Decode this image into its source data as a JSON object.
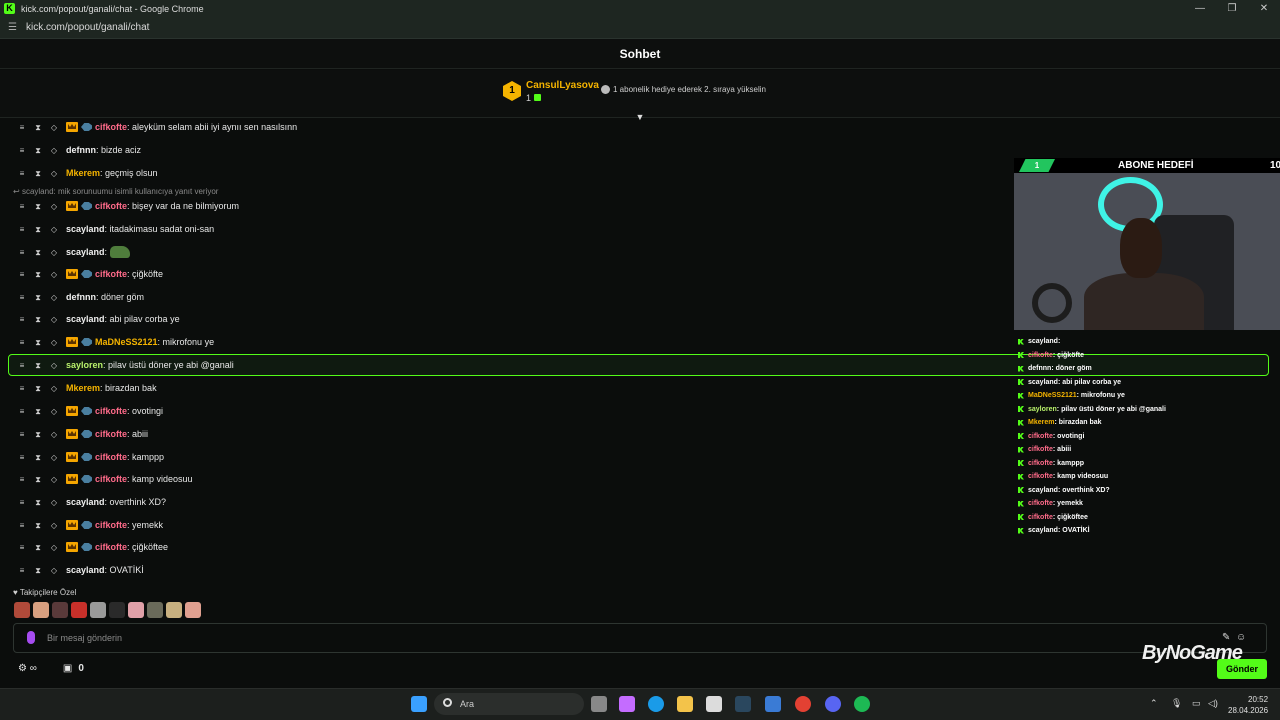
{
  "window": {
    "title": "kick.com/popout/ganali/chat - Google Chrome",
    "url": "kick.com/popout/ganali/chat"
  },
  "chat": {
    "header_title": "Sohbet",
    "pinned": {
      "rank": "1",
      "username": "CansulLyasova",
      "count": "1",
      "hint": "1 abonelik hediye ederek 2. sıraya yükselin"
    },
    "reply_hint": "scayland: mik sorunuumu isimli kullanıcıya yanıt veriyor",
    "messages": [
      {
        "user": "cifkofte",
        "text": ": aleyküm selam abii iyi aynıı sen nasılsınn",
        "color": "#ff6b8a",
        "badges": true
      },
      {
        "user": "defnnn",
        "text": ": bizde aciz",
        "color": "#f0f0f0",
        "badges": false
      },
      {
        "user": "Mkerem",
        "text": ": geçmiş olsun",
        "color": "#f5b400",
        "badges": false
      },
      {
        "user": "cifkofte",
        "text": ": bişey var da ne bilmiyorum",
        "color": "#ff6b8a",
        "badges": true
      },
      {
        "user": "scayland",
        "text": ": itadakimasu sadat oni-san",
        "color": "#f0f0f0",
        "badges": false
      },
      {
        "user": "scayland",
        "text": ":",
        "color": "#f0f0f0",
        "badges": false,
        "emote": true
      },
      {
        "user": "cifkofte",
        "text": ": çiğköfte",
        "color": "#ff6b8a",
        "badges": true
      },
      {
        "user": "defnnn",
        "text": ": döner göm",
        "color": "#f0f0f0",
        "badges": false
      },
      {
        "user": "scayland",
        "text": ": abi pilav corba ye",
        "color": "#f0f0f0",
        "badges": false
      },
      {
        "user": "MaDNeSS2121",
        "text": ": mikrofonu ye",
        "color": "#f5b400",
        "badges": true
      },
      {
        "user": "sayloren",
        "text": ": pilav üstü döner ye abi @ganali",
        "color": "#b9f26b",
        "badges": false
      },
      {
        "user": "Mkerem",
        "text": ": birazdan bak",
        "color": "#f5b400",
        "badges": false
      },
      {
        "user": "cifkofte",
        "text": ": ovotingi",
        "color": "#ff6b8a",
        "badges": true
      },
      {
        "user": "cifkofte",
        "text": ": abiii",
        "color": "#ff6b8a",
        "badges": true
      },
      {
        "user": "cifkofte",
        "text": ": kamppp",
        "color": "#ff6b8a",
        "badges": true
      },
      {
        "user": "cifkofte",
        "text": ": kamp videosuu",
        "color": "#ff6b8a",
        "badges": true
      },
      {
        "user": "scayland",
        "text": ": overthink XD?",
        "color": "#f0f0f0",
        "badges": false
      },
      {
        "user": "cifkofte",
        "text": ": yemekk",
        "color": "#ff6b8a",
        "badges": true
      },
      {
        "user": "cifkofte",
        "text": ": çiğköftee",
        "color": "#ff6b8a",
        "badges": true
      },
      {
        "user": "scayland",
        "text": ": OVATİKİ",
        "color": "#f0f0f0",
        "badges": false
      }
    ],
    "followers_label": "Takipçilere Özel",
    "input_placeholder": "Bir mesaj gönderin",
    "send_label": "Gönder",
    "footer_count": "0"
  },
  "overlay": {
    "goal_title": "ABONE HEDEFİ",
    "goal_current": "1",
    "goal_max": "10",
    "logo": "ByNoGame",
    "messages": [
      {
        "user": "scayland",
        "text": " : ",
        "color": "#ffffff"
      },
      {
        "user": "cifkofte",
        "text": " : çiğköfte",
        "color": "#ff6b8a"
      },
      {
        "user": "defnnn",
        "text": " : döner göm",
        "color": "#ffffff"
      },
      {
        "user": "scayland",
        "text": " : abi pilav corba ye",
        "color": "#ffffff"
      },
      {
        "user": "MaDNeSS2121",
        "text": " : mikrofonu ye",
        "color": "#f5b400"
      },
      {
        "user": "sayloren",
        "text": " : pilav üstü döner ye abi @ganali",
        "color": "#b9f26b"
      },
      {
        "user": "Mkerem",
        "text": " : birazdan bak",
        "color": "#f5b400"
      },
      {
        "user": "cifkofte",
        "text": " : ovotingi",
        "color": "#ff6b8a"
      },
      {
        "user": "cifkofte",
        "text": " : abiii",
        "color": "#ff6b8a"
      },
      {
        "user": "cifkofte",
        "text": " : kamppp",
        "color": "#ff6b8a"
      },
      {
        "user": "cifkofte",
        "text": " : kamp videosuu",
        "color": "#ff6b8a"
      },
      {
        "user": "scayland",
        "text": " : overthink XD?",
        "color": "#ffffff"
      },
      {
        "user": "cifkofte",
        "text": " : yemekk",
        "color": "#ff6b8a"
      },
      {
        "user": "cifkofte",
        "text": " : çiğköftee",
        "color": "#ff6b8a"
      },
      {
        "user": "scayland",
        "text": " : OVATİKİ",
        "color": "#ffffff"
      }
    ]
  },
  "taskbar": {
    "search_label": "Ara",
    "time": "20:52",
    "date": "28.04.2026"
  },
  "colors": {
    "accent": "#53fc18",
    "background": "#0b0d0c"
  }
}
